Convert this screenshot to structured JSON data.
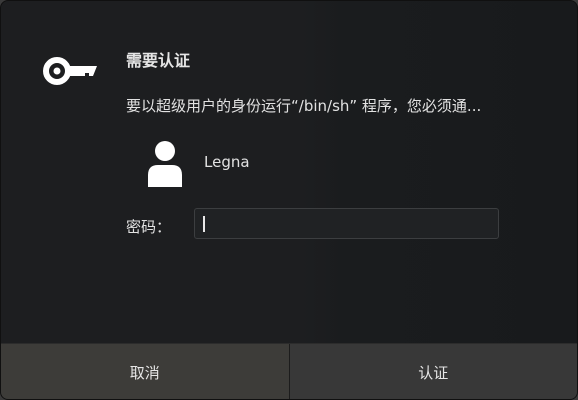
{
  "dialog": {
    "title": "需要认证",
    "message": "要以超级用户的身份运行“/bin/sh” 程序，您必须通...",
    "user": {
      "name": "Legna",
      "icon": "user-icon"
    },
    "password": {
      "label": "密码：",
      "value": ""
    },
    "icon": "key-icon",
    "buttons": {
      "cancel": "取消",
      "authenticate": "认证"
    }
  },
  "colors": {
    "background": "#1d1e20",
    "button_bar": "#3d3c39",
    "text": "#e6e6e6"
  }
}
